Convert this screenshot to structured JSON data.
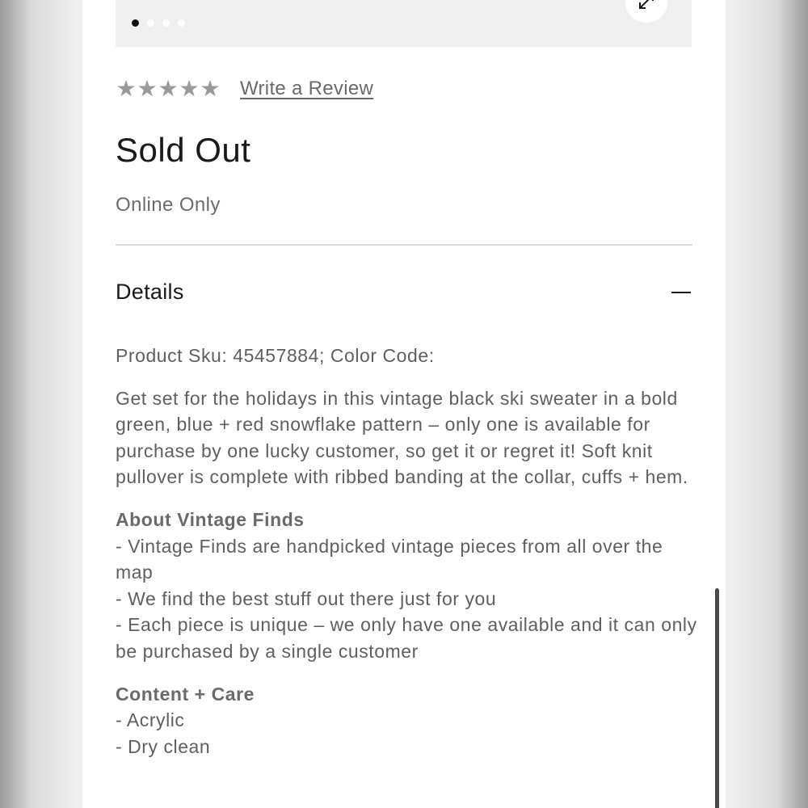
{
  "gallery": {
    "dot_count": 4,
    "active_dot": 0,
    "zoom_icon": "expand-arrows-icon"
  },
  "rating": {
    "stars": 5,
    "star_icon": "star-icon",
    "review_link_label": "Write a Review"
  },
  "product": {
    "status": "Sold Out",
    "availability": "Online Only"
  },
  "details": {
    "title": "Details",
    "collapse_icon": "minus-icon",
    "sku_label": "Product Sku:",
    "sku_value": "45457884;",
    "color_code_label": "Color Code:",
    "description": "Get set for the holidays in this vintage black ski sweater in a bold green, blue + red snowflake pattern – only one is available for purchase by one lucky customer, so get it or regret it! Soft knit pullover is complete with ribbed banding at the collar, cuffs + hem.",
    "sections": [
      {
        "title": "About Vintage Finds",
        "lines": [
          "- Vintage Finds are handpicked vintage pieces from all over the map",
          "- We find the best stuff out there just for you",
          "- Each piece is unique – we only have one available and it can only be purchased by a single customer"
        ]
      },
      {
        "title": "Content + Care",
        "lines": [
          "- Acrylic",
          "- Dry clean"
        ]
      }
    ]
  }
}
